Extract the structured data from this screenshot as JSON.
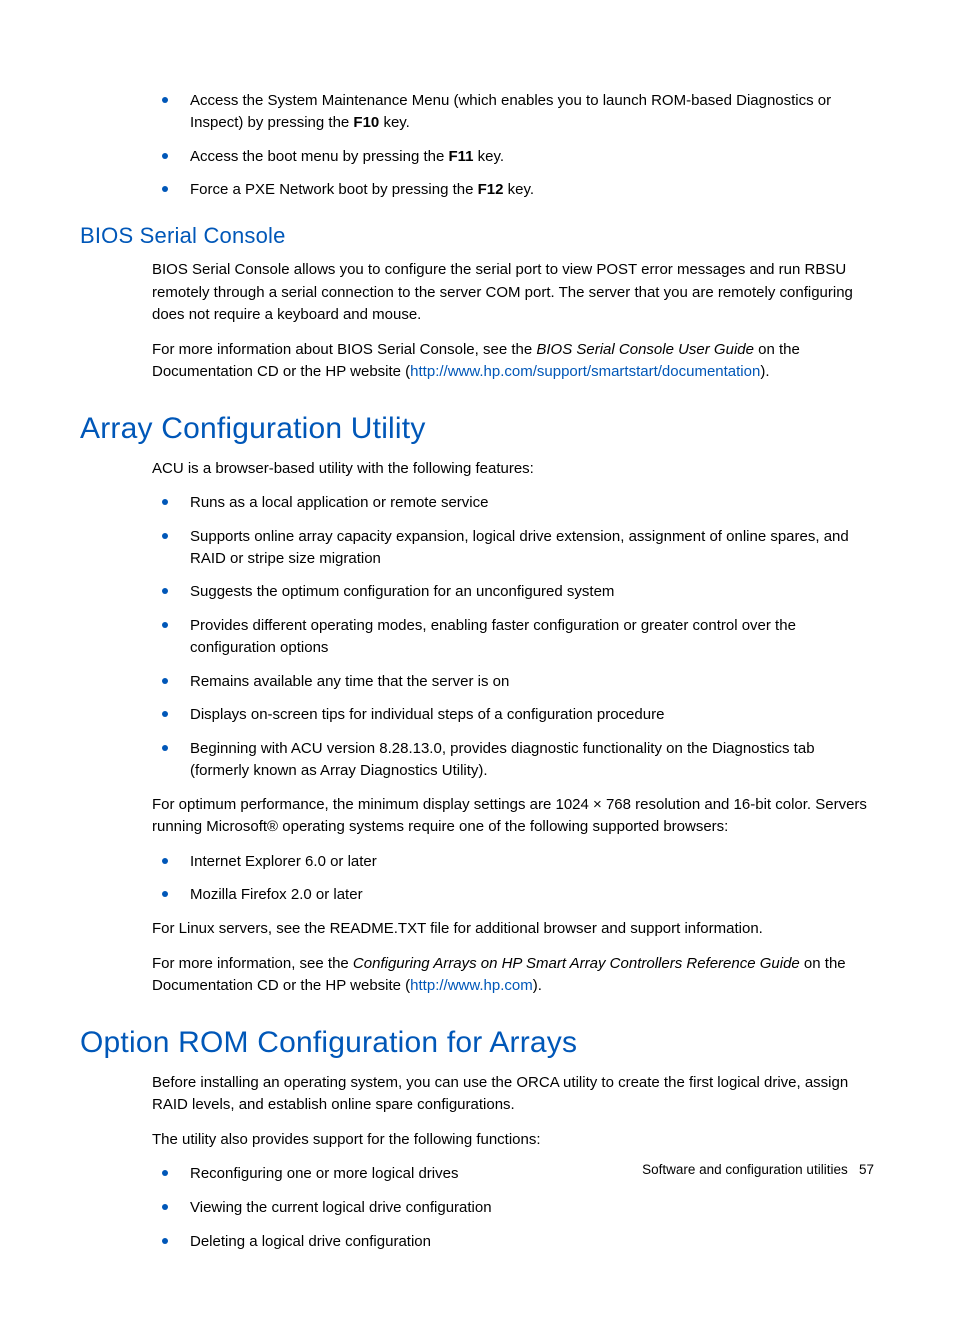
{
  "intro_bullets": [
    {
      "pre": "Access the System Maintenance Menu (which enables you to launch ROM-based Diagnostics or Inspect) by pressing the ",
      "key": "F10",
      "post": " key."
    },
    {
      "pre": "Access the boot menu by pressing the ",
      "key": "F11",
      "post": " key."
    },
    {
      "pre": "Force a PXE Network boot by pressing the ",
      "key": "F12",
      "post": " key."
    }
  ],
  "bios": {
    "heading": "BIOS Serial Console",
    "p1": "BIOS Serial Console allows you to configure the serial port to view POST error messages and run RBSU remotely through a serial connection to the server COM port. The server that you are remotely configuring does not require a keyboard and mouse.",
    "p2_pre": "For more information about BIOS Serial Console, see the ",
    "p2_italic": "BIOS Serial Console User Guide",
    "p2_mid": " on the Documentation CD or the HP website (",
    "p2_link": "http://www.hp.com/support/smartstart/documentation",
    "p2_post": ")."
  },
  "acu": {
    "heading": "Array Configuration Utility",
    "intro": "ACU is a browser-based utility with the following features:",
    "bullets": [
      "Runs as a local application or remote service",
      "Supports online array capacity expansion, logical drive extension, assignment of online spares, and RAID or stripe size migration",
      "Suggests the optimum configuration for an unconfigured system",
      "Provides different operating modes, enabling faster configuration or greater control over the configuration options",
      "Remains available any time that the server is on",
      "Displays on-screen tips for individual steps of a configuration procedure",
      "Beginning with ACU version 8.28.13.0, provides diagnostic functionality on the Diagnostics tab (formerly known as Array Diagnostics Utility)."
    ],
    "perf": "For optimum performance, the minimum display settings are 1024 × 768 resolution and 16-bit color. Servers running Microsoft® operating systems require one of the following supported browsers:",
    "browsers": [
      "Internet Explorer 6.0 or later",
      "Mozilla Firefox 2.0 or later"
    ],
    "linux": "For Linux servers, see the README.TXT file for additional browser and support information.",
    "more_pre": "For more information, see the ",
    "more_italic": "Configuring Arrays on HP Smart Array Controllers Reference Guide",
    "more_mid": " on the Documentation CD or the HP website (",
    "more_link": "http://www.hp.com",
    "more_post": ")."
  },
  "orca": {
    "heading": "Option ROM Configuration for Arrays",
    "p1": "Before installing an operating system, you can use the ORCA utility to create the first logical drive, assign RAID levels, and establish online spare configurations.",
    "p2": "The utility also provides support for the following functions:",
    "bullets": [
      "Reconfiguring one or more logical drives",
      "Viewing the current logical drive configuration",
      "Deleting a logical drive configuration"
    ]
  },
  "footer": {
    "section": "Software and configuration utilities",
    "page": "57"
  }
}
